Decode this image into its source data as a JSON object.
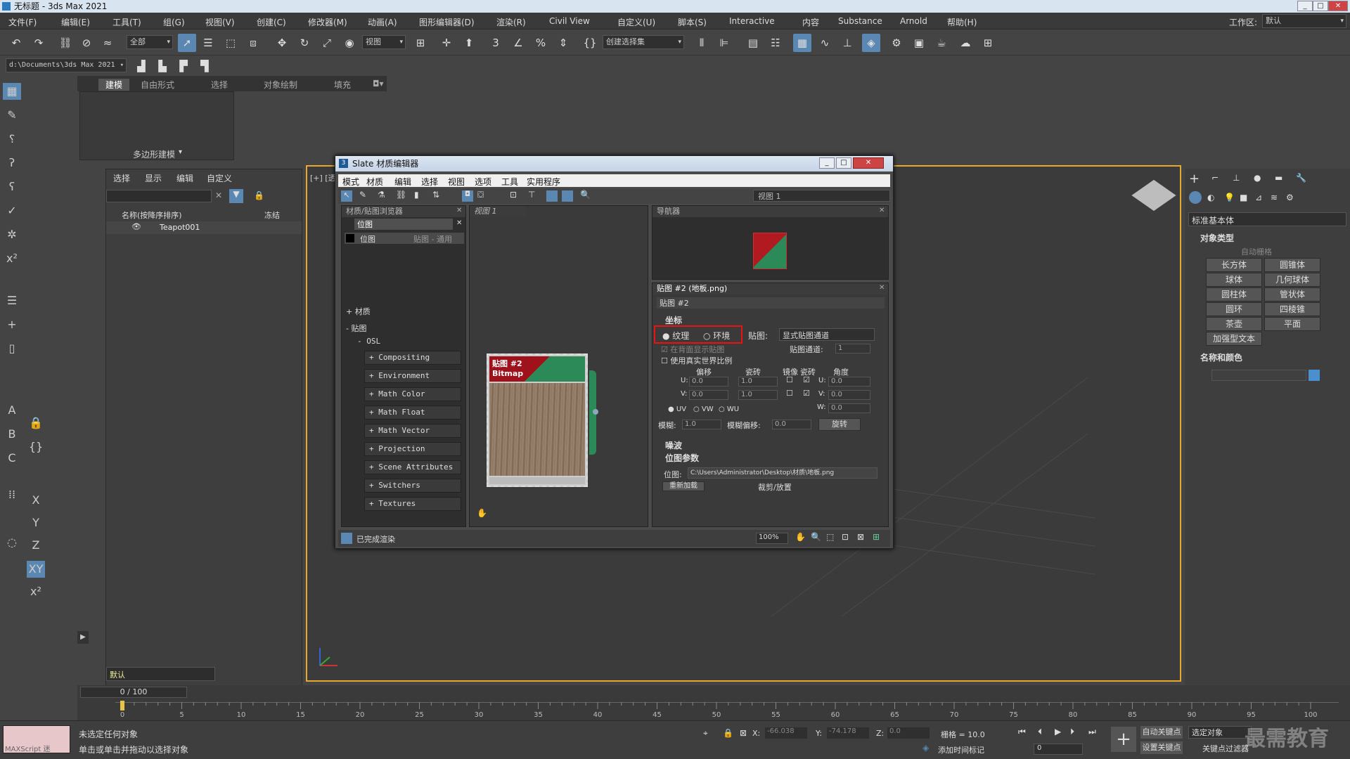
{
  "window": {
    "title": "无标题 - 3ds Max 2021"
  },
  "menu": [
    "文件(F)",
    "编辑(E)",
    "工具(T)",
    "组(G)",
    "视图(V)",
    "创建(C)",
    "修改器(M)",
    "动画(A)",
    "图形编辑器(D)",
    "渲染(R)",
    "Civil View",
    "自定义(U)",
    "脚本(S)",
    "Interactive",
    "内容",
    "Substance",
    "Arnold",
    "帮助(H)"
  ],
  "workspace": {
    "label": "工作区:",
    "value": "默认"
  },
  "toolbar": {
    "selection_filter": "全部",
    "ref_coord": "视图",
    "named_sel": "创建选择集"
  },
  "path": {
    "project": "d:\\Documents\\3ds Max 2021"
  },
  "ribbon": {
    "tabs": [
      "建模",
      "自由形式",
      "选择",
      "对象绘制",
      "填充"
    ],
    "poly_label": "多边形建模"
  },
  "scene_explorer": {
    "tabs": [
      "选择",
      "显示",
      "编辑",
      "自定义"
    ],
    "col_name": "名称(按降序排序)",
    "col_frozen": "冻结",
    "items": [
      "Teapot001"
    ],
    "layer": "默认"
  },
  "viewport": {
    "label": "[+] [透"
  },
  "command_panel": {
    "category": "标准基本体",
    "rollout_type": "对象类型",
    "autogrid": "自动栅格",
    "buttons": [
      "长方体",
      "圆锥体",
      "球体",
      "几何球体",
      "圆柱体",
      "管状体",
      "圆环",
      "四棱锥",
      "茶壶",
      "平面",
      "加强型文本"
    ],
    "rollout_name": "名称和颜色",
    "color": "#4a8fd0"
  },
  "slate": {
    "title": "Slate 材质编辑器",
    "menu": [
      "模式",
      "材质",
      "编辑",
      "选择",
      "视图",
      "选项",
      "工具",
      "实用程序"
    ],
    "view_dropdown": "视图 1",
    "browser": {
      "title": "材质/贴图浏览器",
      "search": "位图",
      "result_name": "位图",
      "result_type": "贴图 - 通用",
      "groups": [
        "+ 材质",
        "- 贴图"
      ],
      "osl": "- OSL",
      "osl_items": [
        "+ Compositing",
        "+ Environment",
        "+ Math Color",
        "+ Math Float",
        "+ Math Vector",
        "+ Projection",
        "+ Scene Attributes",
        "+ Switchers",
        "+ Textures"
      ]
    },
    "view_tab": "视图 1",
    "node": {
      "title": "贴图 #2",
      "type": "Bitmap"
    },
    "navigator": {
      "title": "导航器"
    },
    "params": {
      "title": "贴图 #2 (地板.png)",
      "name": "贴图 #2",
      "rollout_coords": "坐标",
      "texture": "纹理",
      "environ": "环境",
      "map_label": "贴图:",
      "map_value": "显式贴图通道",
      "show_back": "在背面显示贴图",
      "channel_label": "贴图通道:",
      "channel_value": "1",
      "real_world": "使用真实世界比例",
      "headers": [
        "偏移",
        "瓷砖",
        "镜像",
        "瓷砖",
        "角度"
      ],
      "u": {
        "label": "U:",
        "offset": "0.0",
        "tiling": "1.0",
        "angle": "0.0"
      },
      "v": {
        "label": "V:",
        "offset": "0.0",
        "tiling": "1.0",
        "angle": "0.0"
      },
      "w": {
        "label": "W:",
        "angle": "0.0"
      },
      "uv_opts": [
        "UV",
        "VW",
        "WU"
      ],
      "blur_label": "模糊:",
      "blur": "1.0",
      "blur_offset_label": "模糊偏移:",
      "blur_offset": "0.0",
      "rotate": "旋转",
      "rollout_noise": "噪波",
      "rollout_bitmap": "位图参数",
      "bitmap_label": "位图:",
      "bitmap_path": "C:\\Users\\Administrator\\Desktop\\材质\\地板.png",
      "reload": "重新加载",
      "crop": "裁剪/放置"
    },
    "status": "已完成渲染",
    "zoom": "100%"
  },
  "timeline": {
    "frame": "0 / 100",
    "ticks": [
      "0",
      "5",
      "10",
      "15",
      "20",
      "25",
      "30",
      "35",
      "40",
      "45",
      "50",
      "55",
      "60",
      "65",
      "70",
      "75",
      "80",
      "85",
      "90",
      "95",
      "100"
    ]
  },
  "status": {
    "maxscript": "MAXScript 迷",
    "line1": "未选定任何对象",
    "line2": "单击或单击并拖动以选择对象",
    "x": "-66.038",
    "y": "-74.178",
    "z": "0.0",
    "grid": "栅格 = 10.0",
    "add_tag": "添加时间标记",
    "autokey": "自动关键点",
    "selected": "选定对象",
    "setkey": "设置关键点",
    "keyfilter": "关键点过滤器",
    "frame_field": "0",
    "watermark": "最需教育"
  }
}
